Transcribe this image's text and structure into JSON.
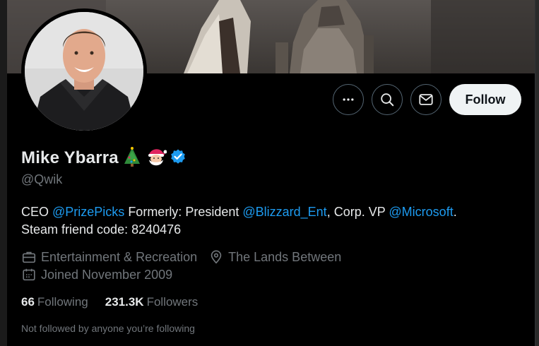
{
  "profile": {
    "display_name": "Mike Ybarra",
    "handle": "@Qwik",
    "name_emojis": [
      "christmas-tree",
      "santa"
    ],
    "verified": true
  },
  "actions": {
    "more_icon": "more-icon",
    "search_icon": "search-icon",
    "message_icon": "message-icon",
    "follow_label": "Follow"
  },
  "bio": {
    "t1": "CEO ",
    "m1": "@PrizePicks",
    "t2": " Formerly: President ",
    "m2": "@Blizzard_Ent",
    "t3": ", Corp. VP ",
    "m3": "@Microsoft",
    "t4": ".",
    "line2": "Steam friend code: 8240476"
  },
  "meta": {
    "category": "Entertainment & Recreation",
    "location": "The Lands Between",
    "joined": "Joined November 2009"
  },
  "stats": {
    "following_count": "66",
    "following_label": "Following",
    "followers_count": "231.3K",
    "followers_label": "Followers"
  },
  "note": "Not followed by anyone you’re following",
  "colors": {
    "background": "#000000",
    "accent": "#1d9bf0",
    "text_primary": "#e7e9ea",
    "text_secondary": "#71767b",
    "follow_bg": "#eff3f4"
  }
}
